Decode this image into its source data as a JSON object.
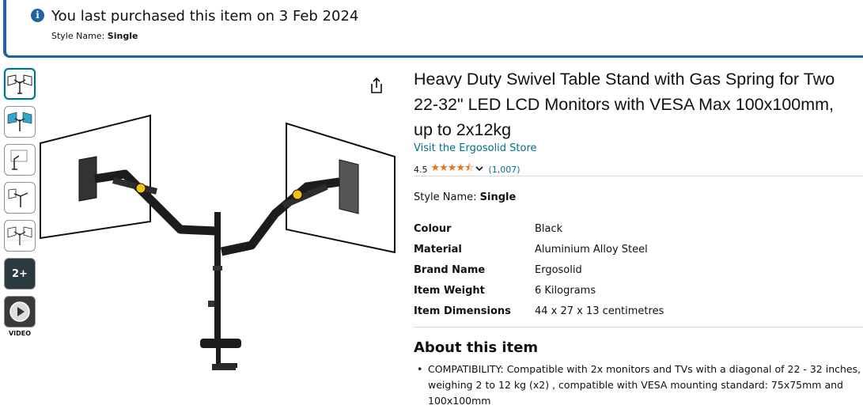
{
  "banner": {
    "message": "You last purchased this item on 3 Feb 2024",
    "style_label": "Style Name:",
    "style_value": "Single",
    "info_icon": "info-icon",
    "accent_color": "#2162a1"
  },
  "gallery": {
    "thumbnails": [
      {
        "name": "thumb-main",
        "selected": true
      },
      {
        "name": "thumb-blue-monitors"
      },
      {
        "name": "thumb-side-view"
      },
      {
        "name": "thumb-arm-closeup"
      },
      {
        "name": "thumb-dimensions"
      }
    ],
    "more_label": "2+",
    "video_label": "VIDEO",
    "share_icon": "share-icon"
  },
  "product": {
    "title": "Heavy Duty Swivel Table Stand with Gas Spring for Two 22-32\" LED LCD Monitors with VESA Max 100x100mm, up to 2x12kg",
    "store_link": "Visit the Ergosolid Store",
    "rating": "4.5",
    "rating_value": 4.5,
    "stars": "★★★★⯪",
    "ratings_count": "(1,007)",
    "style_label": "Style Name:",
    "style_value": "Single"
  },
  "specs": [
    {
      "key": "Colour",
      "value": "Black"
    },
    {
      "key": "Material",
      "value": "Aluminium Alloy Steel"
    },
    {
      "key": "Brand Name",
      "value": "Ergosolid"
    },
    {
      "key": "Item Weight",
      "value": "6 Kilograms"
    },
    {
      "key": "Item Dimensions",
      "value": "44 x 27 x 13 centimetres"
    }
  ],
  "about": {
    "title": "About this item",
    "bullets": [
      "COMPATIBILITY: Compatible with 2x monitors and TVs with a diagonal of 22 - 32 inches, weighing 2 to 12 kg (x2) , compatible with VESA mounting standard: 75x75mm and 100x100mm"
    ]
  },
  "colors": {
    "link": "#007185",
    "star": "#de7921",
    "text": "#0f1111"
  }
}
